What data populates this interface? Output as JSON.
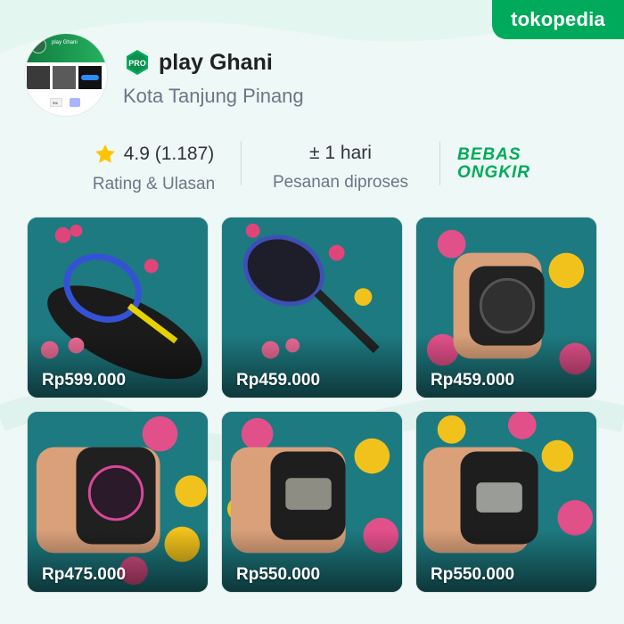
{
  "brand": {
    "name": "tokopedia",
    "color": "#00aa5b"
  },
  "shop": {
    "badge": "PRO",
    "name": "play Ghani",
    "city": "Kota Tanjung Pinang",
    "avatar_title": "play Ghani",
    "avatar_footer": "3%"
  },
  "stats": {
    "rating_icon": "star-icon",
    "rating_value": "4.9 (1.187)",
    "rating_label": "Rating & Ulasan",
    "process_value": "± 1 hari",
    "process_label": "Pesanan diproses",
    "shipping_line1": "BEBAS",
    "shipping_line2": "ONGKIR"
  },
  "products": [
    {
      "price": "Rp599.000",
      "item": "tennis-racket"
    },
    {
      "price": "Rp459.000",
      "item": "tennis-racket"
    },
    {
      "price": "Rp459.000",
      "item": "watch"
    },
    {
      "price": "Rp475.000",
      "item": "watch"
    },
    {
      "price": "Rp550.000",
      "item": "watch"
    },
    {
      "price": "Rp550.000",
      "item": "watch"
    }
  ],
  "colors": {
    "accent": "#00aa5b",
    "star": "#ffc400",
    "card_bg": "#1f7d80"
  }
}
